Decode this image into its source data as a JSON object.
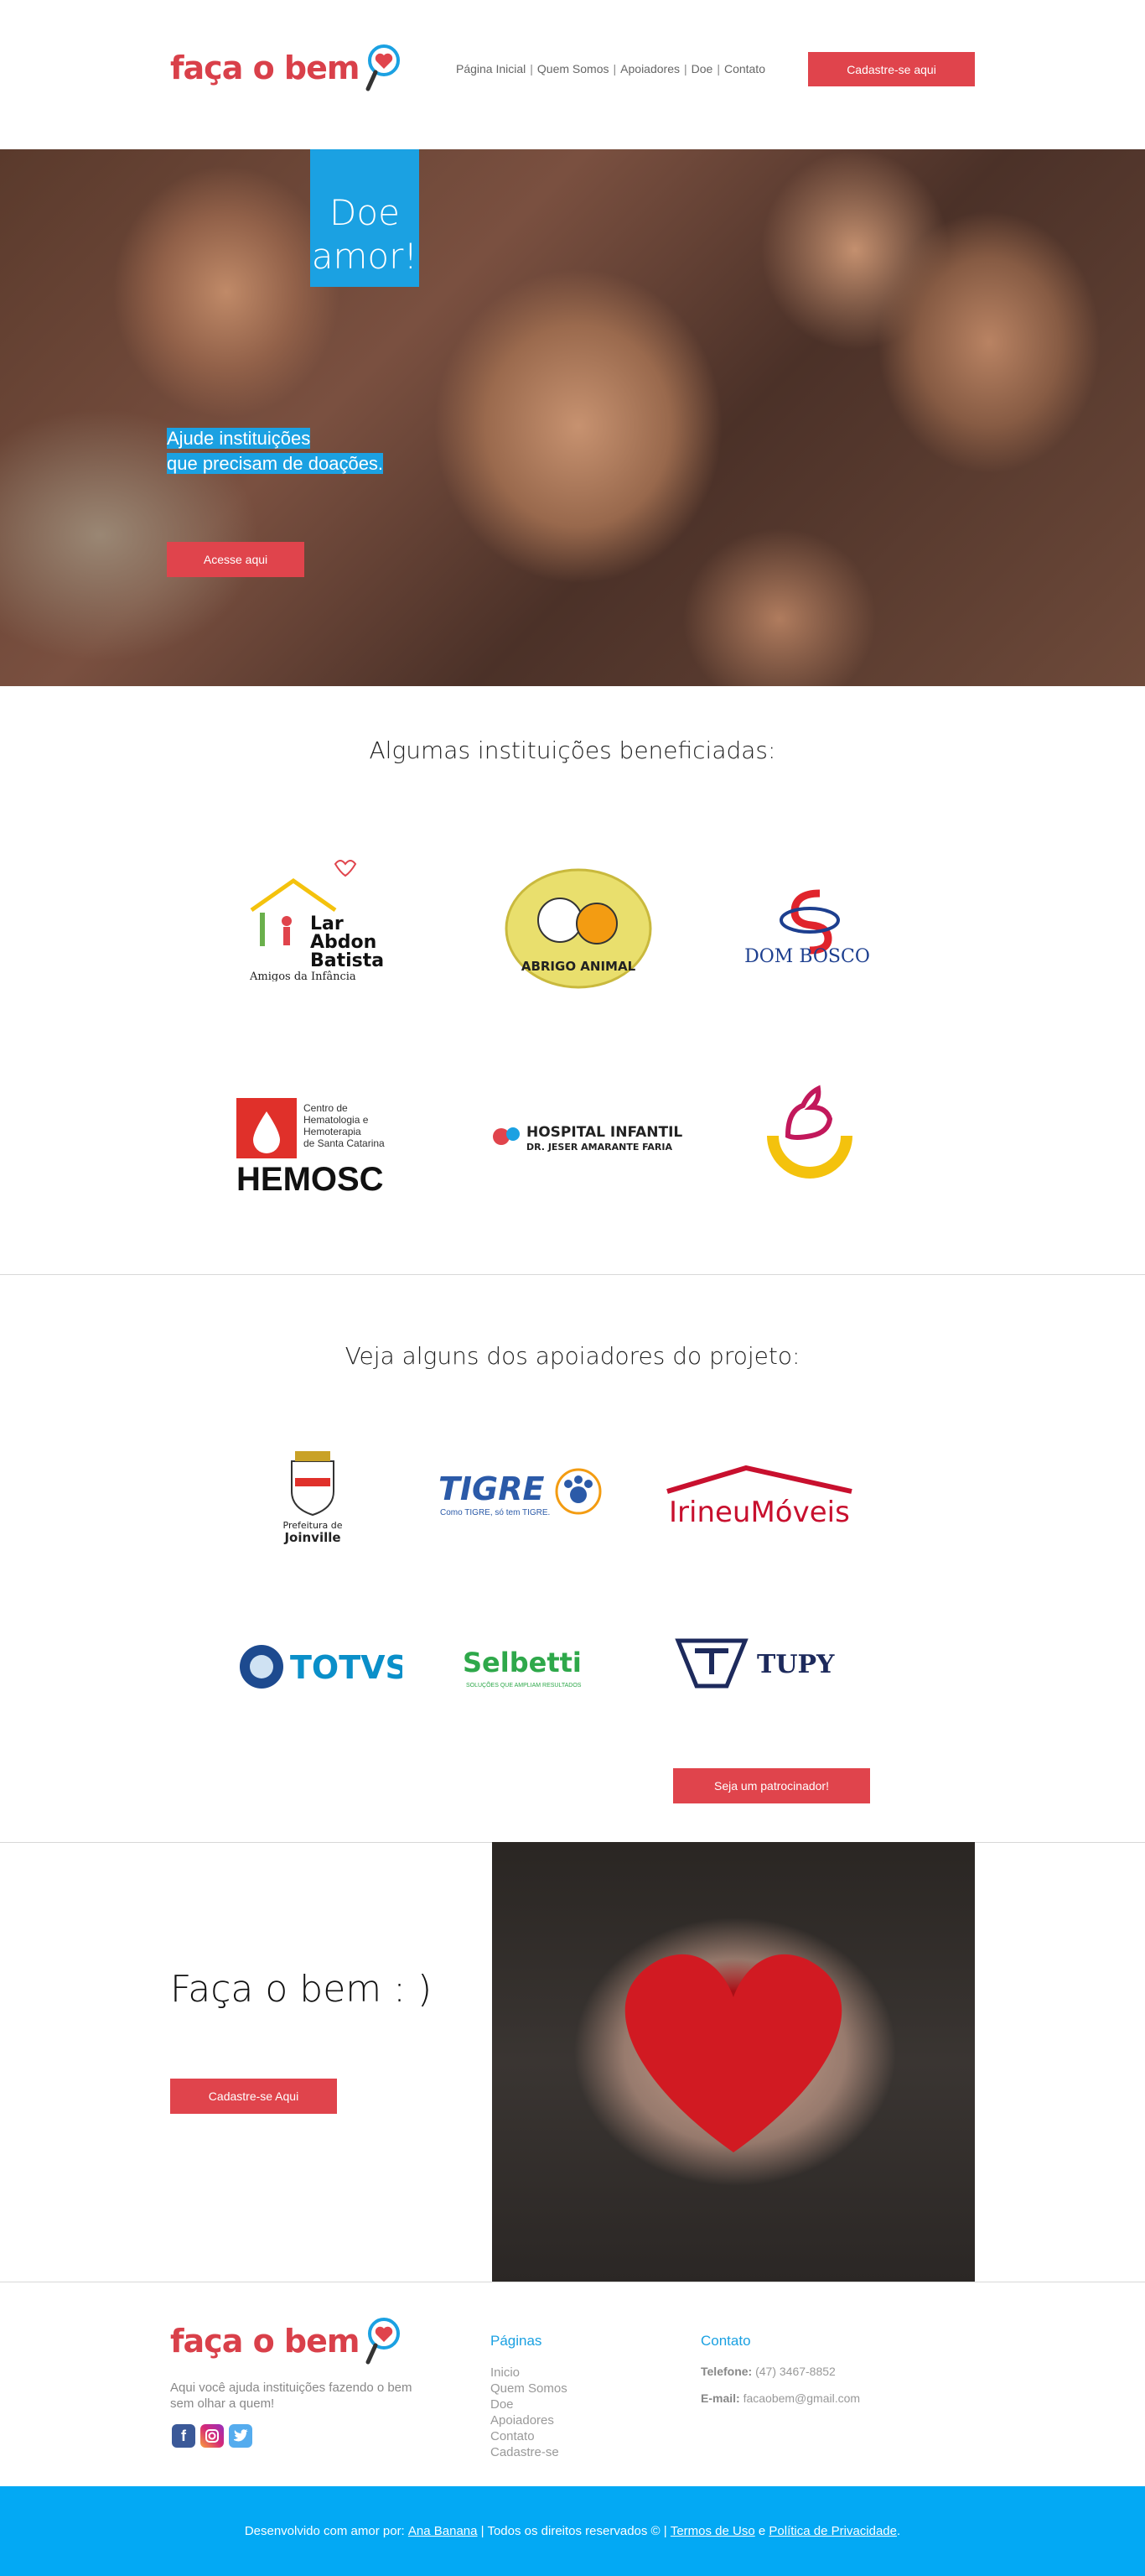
{
  "header": {
    "logo_text": "faça o bem",
    "nav": [
      "Página Inicial",
      "Quem Somos",
      "Apoiadores",
      "Doe",
      "Contato"
    ],
    "cta_label": "Cadastre-se aqui"
  },
  "hero": {
    "badge_line1": "Doe",
    "badge_line2": "amor!",
    "tagline_line1": "Ajude instituições",
    "tagline_line2": "que precisam de doações.",
    "button_label": "Acesse aqui"
  },
  "institutions": {
    "title": "Algumas instituições beneficiadas:",
    "logos": {
      "lar_line1": "Lar",
      "lar_line2": "Abdon",
      "lar_line3": "Batista",
      "lar_sub": "Amigos da Infância",
      "abrigo": "ABRIGO ANIMAL",
      "dombosco": "DOM BOSCO",
      "hemosc_sub1": "Centro de",
      "hemosc_sub2": "Hematologia e",
      "hemosc_sub3": "Hemoterapia",
      "hemosc_sub4": "de Santa Catarina",
      "hemosc": "HEMOSC",
      "hospital_line1": "HOSPITAL INFANTIL",
      "hospital_line2": "DR. JESER AMARANTE FARIA"
    }
  },
  "sponsors": {
    "title": "Veja alguns dos apoiadores do projeto:",
    "logos": {
      "joinville_line1": "Prefeitura de",
      "joinville_line2": "Joinville",
      "tigre": "TIGRE",
      "tigre_sub": "Como TIGRE, só tem TIGRE.",
      "irineu": "IrineuMóveis",
      "totvs": "TOTVS",
      "selbetti": "Selbetti",
      "selbetti_sub": "SOLUÇÕES QUE AMPLIAM RESULTADOS",
      "tupy": "TUPY"
    },
    "button_label": "Seja um patrocinador!"
  },
  "cta": {
    "title": "Faça o bem : )",
    "button_label": "Cadastre-se Aqui"
  },
  "footer": {
    "logo_text": "faça o bem",
    "description": "Aqui você ajuda instituições fazendo o bem sem olhar a quem!",
    "pages_title": "Páginas",
    "pages": [
      "Inicio",
      "Quem Somos",
      "Doe",
      "Apoiadores",
      "Contato",
      "Cadastre-se"
    ],
    "contact_title": "Contato",
    "phone_label": "Telefone:",
    "phone": "(47) 3467-8852",
    "email_label": "E-mail:",
    "email": "facaobem@gmail.com"
  },
  "bottom_bar": {
    "prefix": "Desenvolvido com amor por:",
    "author": "Ana Banana",
    "middle": "| Todos os direitos reservados © |",
    "terms": "Termos de Uso",
    "and": "e",
    "privacy": "Política de Privacidade",
    "suffix": "."
  },
  "colors": {
    "brand_red": "#e0444c",
    "brand_blue": "#1ba1e2",
    "footer_bar": "#03a9f4"
  }
}
